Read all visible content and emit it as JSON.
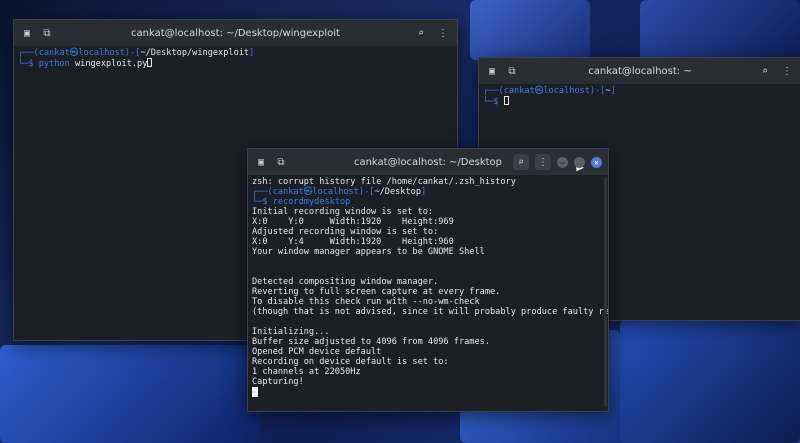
{
  "colors": {
    "accent": "#3d7ce5",
    "terminal_bg": "#1c1f26",
    "titlebar_bg": "#2a2d34",
    "close_button": "#4f7bd6"
  },
  "window1": {
    "title": "cankat@localhost: ~/Desktop/wingexploit",
    "line1": {
      "corner": "┌──(",
      "user": "cankat㉿localhost",
      "sep": ")-[",
      "path": "~/Desktop/wingexploit",
      "end": "]"
    },
    "line2": {
      "corner": "└─",
      "prompt": "$",
      "command": "python",
      "arg": "wingexploit.py"
    }
  },
  "window2": {
    "title": "cankat@localhost: ~",
    "line1": {
      "corner": "┌──(",
      "user": "cankat㉿localhost",
      "sep": ")-[",
      "path": "~",
      "end": "]"
    },
    "line2": {
      "corner": "└─",
      "prompt": "$"
    }
  },
  "window3": {
    "title": "cankat@localhost: ~/Desktop",
    "pre_lines": [
      "zsh: corrupt history file /home/cankat/.zsh_history"
    ],
    "prompt": {
      "corner": "┌──(",
      "user": "cankat㉿localhost",
      "sep": ")-[",
      "path": "~/Desktop",
      "end": "]",
      "corner2": "└─",
      "symbol": "$",
      "command": "recordmydesktop"
    },
    "output": [
      "Initial recording window is set to:",
      "X:0    Y:0     Width:1920    Height:969",
      "Adjusted recording window is set to:",
      "X:0    Y:4     Width:1920    Height:960",
      "Your window manager appears to be GNOME Shell",
      "",
      "",
      "Detected compositing window manager.",
      "Reverting to full screen capture at every frame.",
      "To disable this check run with --no-wm-check",
      "(though that is not advised, since it will probably produce faulty results).",
      "",
      "Initializing...",
      "Buffer size adjusted to 4096 from 4096 frames.",
      "Opened PCM device default",
      "Recording on device default is set to:",
      "1 channels at 22050Hz",
      "Capturing!"
    ]
  },
  "icons": {
    "new_tab": "terminal-icon",
    "split": "split-view-icon",
    "search": "search-icon",
    "menu": "menu-dots-icon",
    "minimize": "minimize-icon",
    "maximize": "maximize-icon",
    "close": "close-icon"
  }
}
